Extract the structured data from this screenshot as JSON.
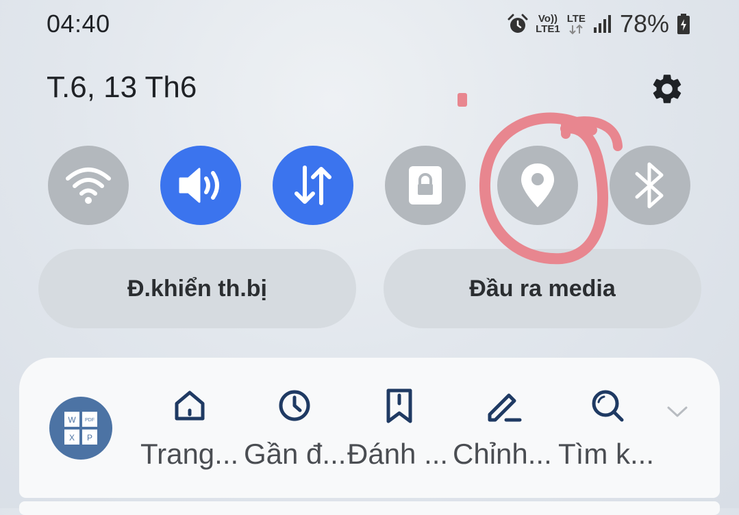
{
  "status_bar": {
    "time": "04:40",
    "volte_label": "Vo))",
    "sim_label": "LTE1",
    "network_label": "LTE",
    "battery_percent": "78%",
    "icons": [
      "alarm-icon",
      "volte-icon",
      "lte-data-icon",
      "signal-icon",
      "battery-charging-icon"
    ]
  },
  "header": {
    "date": "T.6, 13 Th6",
    "settings_icon": "gear-icon"
  },
  "quick_toggles": [
    {
      "name": "wifi",
      "icon": "wifi-icon",
      "state": "off"
    },
    {
      "name": "sound",
      "icon": "speaker-icon",
      "state": "on"
    },
    {
      "name": "mobile-data",
      "icon": "data-transfer-icon",
      "state": "on"
    },
    {
      "name": "screen-lock",
      "icon": "lock-icon",
      "state": "off"
    },
    {
      "name": "location",
      "icon": "location-pin-icon",
      "state": "off"
    },
    {
      "name": "bluetooth",
      "icon": "bluetooth-icon",
      "state": "off"
    }
  ],
  "pills": {
    "device_control": "Đ.khiển th.bị",
    "media_output": "Đầu ra media"
  },
  "shortcuts_card": {
    "app_icon": "document-reader-app-icon",
    "app_icon_letters": [
      "W",
      "PDF",
      "X",
      "P"
    ],
    "items": [
      {
        "icon": "home-icon",
        "label": "Trang..."
      },
      {
        "icon": "clock-icon",
        "label": "Gần đ..."
      },
      {
        "icon": "bookmark-icon",
        "label": "Đánh ..."
      },
      {
        "icon": "edit-icon",
        "label": "Chỉnh..."
      },
      {
        "icon": "search-icon",
        "label": "Tìm k..."
      }
    ],
    "expand_icon": "chevron-down-icon"
  },
  "colors": {
    "toggle_on": "#3b74ee",
    "toggle_off": "#b3b8bd",
    "pill_bg": "#d6dbe0",
    "card_bg": "#f8f9fa",
    "shortcut_icon": "#1f3a63",
    "app_icon_bg": "#4c73a4",
    "annotation": "#e8868f"
  }
}
